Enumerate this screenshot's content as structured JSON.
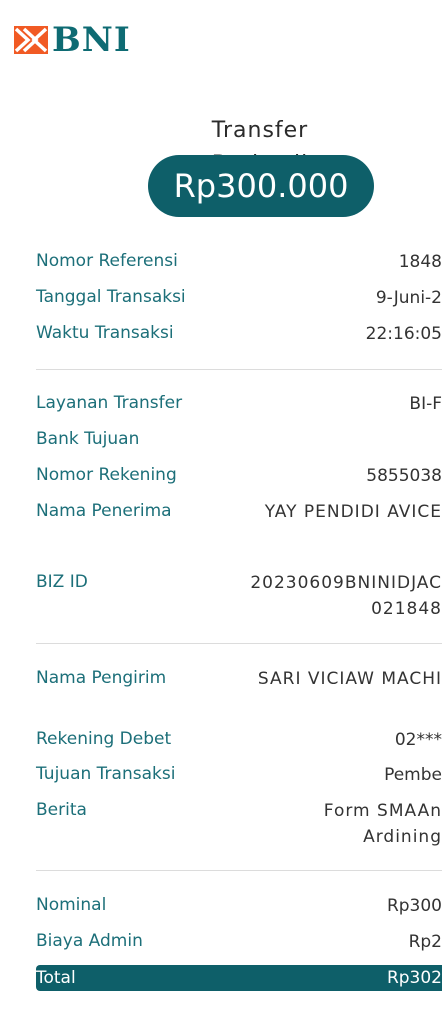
{
  "brand": {
    "name": "BNI"
  },
  "header": {
    "title": "Transfer Berhasil",
    "amount": "Rp300.000"
  },
  "details": {
    "ref_label": "Nomor Referensi",
    "ref_value": "1848",
    "date_label": "Tanggal Transaksi",
    "date_value": "9-Juni-2",
    "time_label": "Waktu Transaksi",
    "time_value": "22:16:05",
    "service_label": "Layanan Transfer",
    "service_value": "BI-F",
    "bank_label": "Bank Tujuan",
    "acct_label": "Nomor Rekening",
    "acct_value": "5855038",
    "recipient_label": "Nama Penerima",
    "recipient_value": "YAY PENDIDI AVICE",
    "bizid_label": "BIZ ID",
    "bizid_value": "20230609BNINIDJAC 021848"
  },
  "sender": {
    "name_label": "Nama Pengirim",
    "name_value": "SARI VICIAW MACHI",
    "debit_label": "Rekening Debet",
    "debit_value": "02***",
    "purpose_label": "Tujuan Transaksi",
    "purpose_value": "Pembe",
    "note_label": "Berita",
    "note_value": "Form SMAAn Ardining"
  },
  "totals": {
    "nominal_label": "Nominal",
    "nominal_value": "Rp300",
    "fee_label": "Biaya Admin",
    "fee_value": "Rp2",
    "total_label": "Total",
    "total_value": "Rp302"
  },
  "colors": {
    "brand_teal": "#0e5f69",
    "label_teal": "#1c6f79",
    "brand_orange": "#f15a24"
  }
}
